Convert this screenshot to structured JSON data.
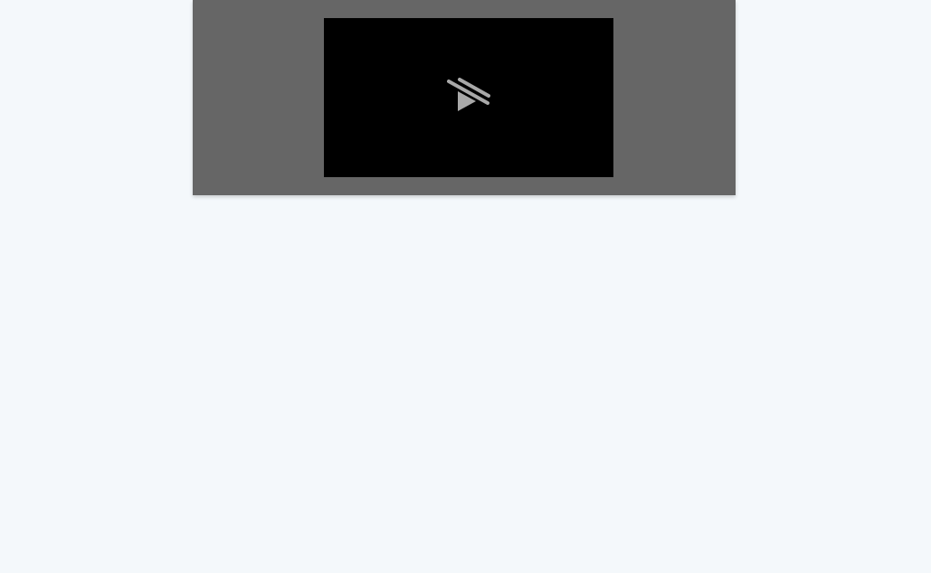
{
  "colors": {
    "page_background": "#f4f8fb",
    "panel_background": "#666666",
    "video_background": "#000000",
    "icon_color": "#a9a9a9"
  },
  "video": {
    "state_icon": "play-disabled-icon"
  }
}
